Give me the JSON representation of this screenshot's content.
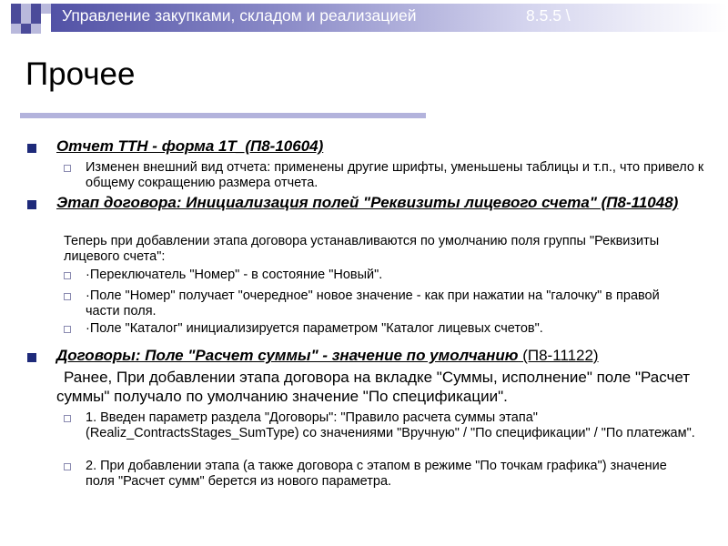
{
  "header": {
    "title": "Управление закупками, складом и реализацией",
    "version": "8.5.5 \\",
    "accent_color": "#5252a6"
  },
  "page": {
    "title": "Прочее"
  },
  "items": [
    {
      "heading": "Отчет ТТН - форма 1Т_(П8-10604)",
      "subs": [
        "Изменен внешний вид отчета: применены другие шрифты, уменьшены таблицы и т.п., что привело к общему сокращению размера отчета."
      ]
    },
    {
      "heading": "Этап договора: Инициализация полей \"Реквизиты лицевого счета\" (П8-11048)",
      "intro": "Теперь при добавлении этапа договора устанавливаются по умолчанию поля группы \"Реквизиты лицевого счета\":",
      "subs": [
        "·Переключатель \"Номер\" - в состояние \"Новый\".",
        "·Поле \"Номер\" получает \"очередное\" новое значение - как при нажатии на \"галочку\" в правой части поля.",
        "·Поле \"Каталог\" инициализируется параметром \"Каталог лицевых счетов\"."
      ]
    },
    {
      "heading": "Договоры: Поле \"Расчет суммы\" - значение по умолчанию",
      "heading_code": " (П8-11122)",
      "intro": "Ранее, При добавлении этапа договора на вкладке \"Суммы, исполнение\" поле \"Расчет суммы\" получало по умолчанию значение \"По спецификации\".",
      "subs": [
        "1. Введен параметр раздела \"Договоры\": \"Правило расчета суммы этапа\" (Realiz_ContractsStages_SumType) со значениями \"Вручную\" / \"По спецификации\" / \"По платежам\".",
        "2. При добавлении этапа (а также договора с этапом в режиме \"По точкам графика\") значение поля \"Расчет сумм\" берется из нового параметра."
      ]
    }
  ]
}
